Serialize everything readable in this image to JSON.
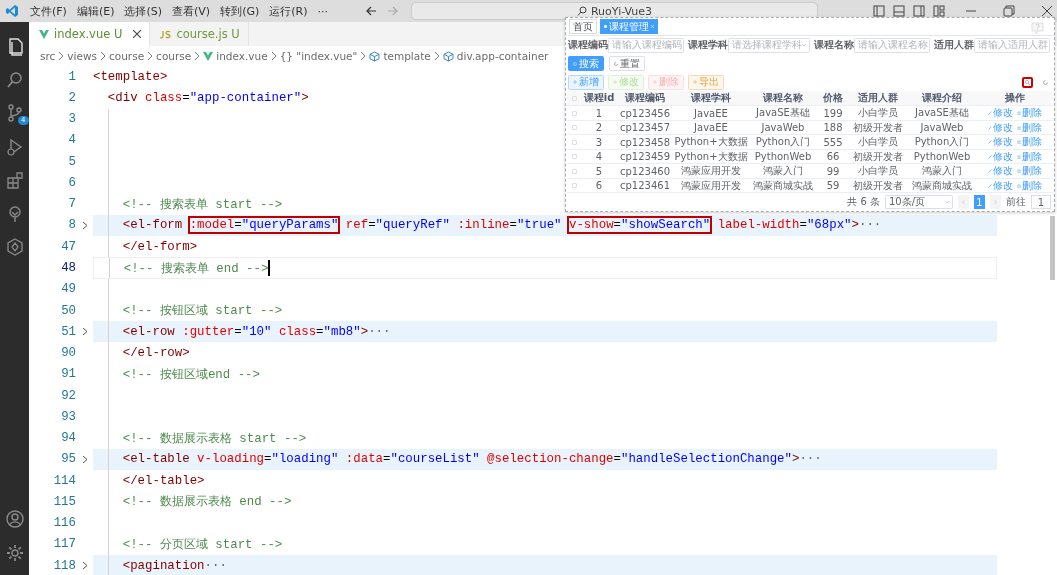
{
  "title_bar": {
    "menus": [
      "文件(F)",
      "编辑(E)",
      "选择(S)",
      "查看(V)",
      "转到(G)",
      "运行(R)",
      "···"
    ],
    "search": {
      "value": "RuoYi-Vue3"
    }
  },
  "activity_bar": {
    "items": [
      {
        "kind": "explorer",
        "selected": true
      },
      {
        "kind": "search",
        "selected": false
      },
      {
        "kind": "source-control",
        "selected": false,
        "badge": "4"
      },
      {
        "kind": "run",
        "selected": false
      },
      {
        "kind": "extensions",
        "selected": false
      },
      {
        "kind": "tree",
        "selected": false
      },
      {
        "kind": "remote",
        "selected": false
      }
    ],
    "bottom": [
      {
        "kind": "account"
      },
      {
        "kind": "settings"
      }
    ]
  },
  "tabs": [
    {
      "label": "index.vue",
      "status": "U",
      "kind": "vue",
      "selected": true,
      "closable": true
    },
    {
      "label": "course.js",
      "status": "U",
      "kind": "js",
      "selected": false,
      "closable": false
    }
  ],
  "breadcrumb": [
    {
      "kind": "folder",
      "label": "src"
    },
    {
      "kind": "folder",
      "label": "views"
    },
    {
      "kind": "folder",
      "label": "course"
    },
    {
      "kind": "folder",
      "label": "course"
    },
    {
      "kind": "vue",
      "label": "index.vue"
    },
    {
      "kind": "object",
      "glyph": "{}",
      "label": "\"index.vue\""
    },
    {
      "kind": "symbol",
      "label": "template"
    },
    {
      "kind": "symbol",
      "label": "div.app-container"
    }
  ],
  "editor": {
    "lines": [
      {
        "number": "1",
        "folded": false,
        "current": false,
        "tokens": [
          {
            "kind": "tag",
            "text": "<template>"
          }
        ]
      },
      {
        "number": "2",
        "folded": false,
        "current": false,
        "tokens": [
          {
            "kind": "tag",
            "text": "  <div"
          },
          {
            "kind": "attr",
            "text": " class"
          },
          {
            "kind": "plain",
            "text": "="
          },
          {
            "kind": "str",
            "text": "\"app-container\""
          },
          {
            "kind": "tag",
            "text": ">"
          }
        ]
      },
      {
        "number": "3",
        "folded": false,
        "current": false
      },
      {
        "number": "4",
        "folded": false,
        "current": false
      },
      {
        "number": "5",
        "folded": false,
        "current": false
      },
      {
        "number": "6",
        "folded": false,
        "current": false
      },
      {
        "number": "7",
        "folded": false,
        "current": false,
        "tokens": [
          {
            "kind": "comment",
            "text": "    <!-- 搜索表单 start -->"
          }
        ]
      },
      {
        "number": "8",
        "folded": true,
        "current": false,
        "tokens": [
          {
            "kind": "tag",
            "text": "    <el-form "
          },
          {
            "kind": "boxed",
            "parts": [
              {
                "kind": "attr",
                "text": ":model"
              },
              {
                "kind": "plain",
                "text": "="
              },
              {
                "kind": "str",
                "text": "\"queryParams\""
              }
            ]
          },
          {
            "kind": "attr",
            "text": " ref"
          },
          {
            "kind": "plain",
            "text": "="
          },
          {
            "kind": "str",
            "text": "\"queryRef\""
          },
          {
            "kind": "attr",
            "text": " :inline"
          },
          {
            "kind": "plain",
            "text": "="
          },
          {
            "kind": "str",
            "text": "\"true\" "
          },
          {
            "kind": "boxed",
            "parts": [
              {
                "kind": "attr",
                "text": "v-show"
              },
              {
                "kind": "plain",
                "text": "="
              },
              {
                "kind": "str",
                "text": "\"showSearch\""
              }
            ]
          },
          {
            "kind": "attr",
            "text": " label-width"
          },
          {
            "kind": "plain",
            "text": "="
          },
          {
            "kind": "str",
            "text": "\"68px\""
          },
          {
            "kind": "tag",
            "text": ">"
          },
          {
            "kind": "ellipsis",
            "text": "···"
          }
        ]
      },
      {
        "number": "47",
        "folded": false,
        "current": false,
        "tokens": [
          {
            "kind": "tag",
            "text": "    </el-form>"
          }
        ]
      },
      {
        "number": "48",
        "folded": false,
        "current": true,
        "tokens": [
          {
            "kind": "comment",
            "text": "    <!-- 搜索表单 end -->"
          }
        ]
      },
      {
        "number": "49",
        "folded": false,
        "current": false
      },
      {
        "number": "50",
        "folded": false,
        "current": false,
        "tokens": [
          {
            "kind": "comment",
            "text": "    <!-- 按钮区域 start -->"
          }
        ]
      },
      {
        "number": "51",
        "folded": true,
        "current": false,
        "tokens": [
          {
            "kind": "tag",
            "text": "    <el-row"
          },
          {
            "kind": "attr",
            "text": " :gutter"
          },
          {
            "kind": "plain",
            "text": "="
          },
          {
            "kind": "str",
            "text": "\"10\""
          },
          {
            "kind": "attr",
            "text": " class"
          },
          {
            "kind": "plain",
            "text": "="
          },
          {
            "kind": "str",
            "text": "\"mb8\""
          },
          {
            "kind": "tag",
            "text": ">"
          },
          {
            "kind": "ellipsis",
            "text": "···"
          }
        ]
      },
      {
        "number": "90",
        "folded": false,
        "current": false,
        "tokens": [
          {
            "kind": "tag",
            "text": "    </el-row>"
          }
        ]
      },
      {
        "number": "91",
        "folded": false,
        "current": false,
        "tokens": [
          {
            "kind": "comment",
            "text": "    <!-- 按钮区域end -->"
          }
        ]
      },
      {
        "number": "92",
        "folded": false,
        "current": false
      },
      {
        "number": "93",
        "folded": false,
        "current": false
      },
      {
        "number": "94",
        "folded": false,
        "current": false,
        "tokens": [
          {
            "kind": "comment",
            "text": "    <!-- 数据展示表格 start -->"
          }
        ]
      },
      {
        "number": "95",
        "folded": true,
        "current": false,
        "tokens": [
          {
            "kind": "tag",
            "text": "    <el-table"
          },
          {
            "kind": "attr",
            "text": " v-loading"
          },
          {
            "kind": "plain",
            "text": "="
          },
          {
            "kind": "str",
            "text": "\"loading\""
          },
          {
            "kind": "attr",
            "text": " :data"
          },
          {
            "kind": "plain",
            "text": "="
          },
          {
            "kind": "str",
            "text": "\"courseList\""
          },
          {
            "kind": "attr",
            "text": " @selection-change"
          },
          {
            "kind": "plain",
            "text": "="
          },
          {
            "kind": "str",
            "text": "\"handleSelectionChange\""
          },
          {
            "kind": "tag",
            "text": ">"
          },
          {
            "kind": "ellipsis",
            "text": "···"
          }
        ]
      },
      {
        "number": "114",
        "folded": false,
        "current": false,
        "tokens": [
          {
            "kind": "tag",
            "text": "    </el-table>"
          }
        ]
      },
      {
        "number": "115",
        "folded": false,
        "current": false,
        "tokens": [
          {
            "kind": "comment",
            "text": "    <!-- 数据展示表格 end -->"
          }
        ]
      },
      {
        "number": "116",
        "folded": false,
        "current": false
      },
      {
        "number": "117",
        "folded": false,
        "current": false,
        "tokens": [
          {
            "kind": "comment",
            "text": "    <!-- 分页区域 start -->"
          }
        ]
      },
      {
        "number": "118",
        "folded": true,
        "current": false,
        "tokens": [
          {
            "kind": "tag",
            "text": "    <pagination"
          },
          {
            "kind": "ellipsis",
            "text": "···"
          }
        ]
      }
    ]
  },
  "preview": {
    "tabs": [
      {
        "label": "首页",
        "selected": false,
        "closable": false
      },
      {
        "label": "课程管理",
        "selected": true,
        "closable": true
      }
    ],
    "filters": [
      {
        "kind": "input",
        "label": "课程编码",
        "placeholder": "请输入课程编码"
      },
      {
        "kind": "select",
        "label": "课程学科",
        "placeholder": "请选择课程学科"
      },
      {
        "kind": "input",
        "label": "课程名称",
        "placeholder": "请输入课程名称"
      },
      {
        "kind": "input",
        "label": "适用人群",
        "placeholder": "请输入适用人群"
      }
    ],
    "search_buttons": [
      {
        "kind": "primary",
        "label": "搜索"
      },
      {
        "kind": "default",
        "label": "重置"
      }
    ],
    "action_buttons": [
      {
        "kind": "add",
        "label": "新增",
        "disabled": false
      },
      {
        "kind": "edit",
        "label": "修改",
        "disabled": true
      },
      {
        "kind": "delete",
        "label": "删除",
        "disabled": true
      },
      {
        "kind": "export",
        "label": "导出",
        "disabled": false
      }
    ],
    "tools": [
      {
        "kind": "search-toggle",
        "annotated": true
      },
      {
        "kind": "refresh",
        "annotated": false
      }
    ],
    "table": {
      "all_selected": false,
      "columns": [
        "课程id",
        "课程编码",
        "课程学科",
        "课程名称",
        "价格",
        "适用人群",
        "课程介绍",
        "操作"
      ],
      "rows": [
        {
          "selected": false,
          "cells": [
            "1",
            "cp123456",
            "JavaEE",
            "JavaSE基础",
            "199",
            "小白学员",
            "JavaSE基础"
          ],
          "actions": [
            "修改",
            "删除"
          ]
        },
        {
          "selected": false,
          "cells": [
            "2",
            "cp123457",
            "JavaEE",
            "JavaWeb",
            "188",
            "初级开发者",
            "JavaWeb"
          ],
          "actions": [
            "修改",
            "删除"
          ]
        },
        {
          "selected": false,
          "cells": [
            "3",
            "cp123458",
            "Python+大数据",
            "Python入门",
            "555",
            "小白学员",
            "Python入门"
          ],
          "actions": [
            "修改",
            "删除"
          ]
        },
        {
          "selected": false,
          "cells": [
            "4",
            "cp123459",
            "Python+大数据",
            "PythonWeb",
            "66",
            "初级开发者",
            "PythonWeb"
          ],
          "actions": [
            "修改",
            "删除"
          ]
        },
        {
          "selected": false,
          "cells": [
            "5",
            "cp123460",
            "鸿蒙应用开发",
            "鸿蒙入门",
            "99",
            "小白学员",
            "鸿蒙入门"
          ],
          "actions": [
            "修改",
            "删除"
          ]
        },
        {
          "selected": false,
          "cells": [
            "6",
            "cp123461",
            "鸿蒙应用开发",
            "鸿蒙商城实战",
            "59",
            "初级开发者",
            "鸿蒙商城实战"
          ],
          "actions": [
            "修改",
            "删除"
          ]
        }
      ]
    },
    "pagination": {
      "total": "共 6 条",
      "page_size": "10条/页",
      "pages": [
        {
          "label": "1",
          "selected": true
        }
      ],
      "goto_label": "前往",
      "goto_value": "1"
    }
  }
}
